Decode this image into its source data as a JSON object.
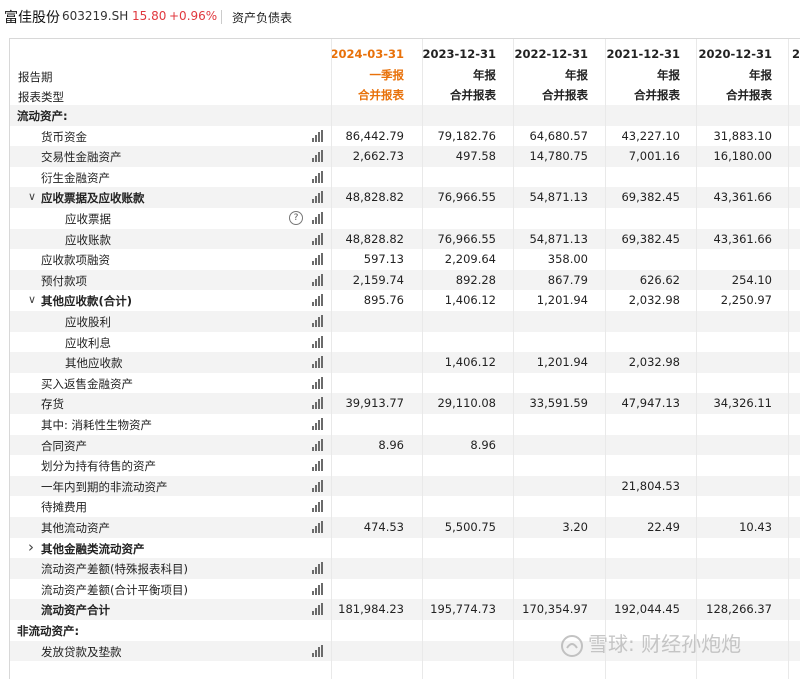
{
  "header": {
    "name": "富佳股份",
    "code": "603219.SH",
    "price": "15.80",
    "change": "+0.96%",
    "report_name": "资产负债表"
  },
  "columns": [
    {
      "date": "2024-03-31",
      "period": "一季报",
      "type": "合并报表",
      "highlight": true
    },
    {
      "date": "2023-12-31",
      "period": "年报",
      "type": "合并报表",
      "highlight": false
    },
    {
      "date": "2022-12-31",
      "period": "年报",
      "type": "合并报表",
      "highlight": false
    },
    {
      "date": "2021-12-31",
      "period": "年报",
      "type": "合并报表",
      "highlight": false
    },
    {
      "date": "2020-12-31",
      "period": "年报",
      "type": "合并报表",
      "highlight": false
    }
  ],
  "partial_column_date": "2",
  "row_labels": {
    "period_label": "报告期",
    "type_label": "报表类型"
  },
  "rows": [
    {
      "label": "流动资产:",
      "indent": 0,
      "bold": true,
      "section": true,
      "values": [
        "",
        "",
        "",
        "",
        ""
      ]
    },
    {
      "label": "货币资金",
      "indent": 1,
      "values": [
        "86,442.79",
        "79,182.76",
        "64,680.57",
        "43,227.10",
        "31,883.10"
      ]
    },
    {
      "label": "交易性金融资产",
      "indent": 1,
      "values": [
        "2,662.73",
        "497.58",
        "14,780.75",
        "7,001.16",
        "16,180.00"
      ]
    },
    {
      "label": "衍生金融资产",
      "indent": 1,
      "values": [
        "",
        "",
        "",
        "",
        ""
      ]
    },
    {
      "label": "应收票据及应收账款",
      "indent": 1,
      "bold": true,
      "chevron": "down",
      "values": [
        "48,828.82",
        "76,966.55",
        "54,871.13",
        "69,382.45",
        "43,361.66"
      ]
    },
    {
      "label": "应收票据",
      "indent": 2,
      "help": true,
      "values": [
        "",
        "",
        "",
        "",
        ""
      ]
    },
    {
      "label": "应收账款",
      "indent": 2,
      "values": [
        "48,828.82",
        "76,966.55",
        "54,871.13",
        "69,382.45",
        "43,361.66"
      ]
    },
    {
      "label": "应收款项融资",
      "indent": 1,
      "values": [
        "597.13",
        "2,209.64",
        "358.00",
        "",
        ""
      ]
    },
    {
      "label": "预付款项",
      "indent": 1,
      "values": [
        "2,159.74",
        "892.28",
        "867.79",
        "626.62",
        "254.10"
      ]
    },
    {
      "label": "其他应收款(合计)",
      "indent": 1,
      "bold": true,
      "chevron": "down",
      "values": [
        "895.76",
        "1,406.12",
        "1,201.94",
        "2,032.98",
        "2,250.97"
      ]
    },
    {
      "label": "应收股利",
      "indent": 2,
      "values": [
        "",
        "",
        "",
        "",
        ""
      ]
    },
    {
      "label": "应收利息",
      "indent": 2,
      "values": [
        "",
        "",
        "",
        "",
        ""
      ]
    },
    {
      "label": "其他应收款",
      "indent": 2,
      "values": [
        "",
        "1,406.12",
        "1,201.94",
        "2,032.98",
        ""
      ]
    },
    {
      "label": "买入返售金融资产",
      "indent": 1,
      "values": [
        "",
        "",
        "",
        "",
        ""
      ]
    },
    {
      "label": "存货",
      "indent": 1,
      "values": [
        "39,913.77",
        "29,110.08",
        "33,591.59",
        "47,947.13",
        "34,326.11"
      ]
    },
    {
      "label": "其中: 消耗性生物资产",
      "indent": 1,
      "values": [
        "",
        "",
        "",
        "",
        ""
      ]
    },
    {
      "label": "合同资产",
      "indent": 1,
      "values": [
        "8.96",
        "8.96",
        "",
        "",
        ""
      ]
    },
    {
      "label": "划分为持有待售的资产",
      "indent": 1,
      "values": [
        "",
        "",
        "",
        "",
        ""
      ]
    },
    {
      "label": "一年内到期的非流动资产",
      "indent": 1,
      "values": [
        "",
        "",
        "",
        "21,804.53",
        ""
      ]
    },
    {
      "label": "待摊费用",
      "indent": 1,
      "values": [
        "",
        "",
        "",
        "",
        ""
      ]
    },
    {
      "label": "其他流动资产",
      "indent": 1,
      "values": [
        "474.53",
        "5,500.75",
        "3.20",
        "22.49",
        "10.43"
      ]
    },
    {
      "label": "其他金融类流动资产",
      "indent": 1,
      "bold": true,
      "chevron": "right",
      "nochart": true,
      "values": [
        "",
        "",
        "",
        "",
        ""
      ]
    },
    {
      "label": "流动资产差额(特殊报表科目)",
      "indent": 1,
      "values": [
        "",
        "",
        "",
        "",
        ""
      ]
    },
    {
      "label": "流动资产差额(合计平衡项目)",
      "indent": 1,
      "values": [
        "",
        "",
        "",
        "",
        ""
      ]
    },
    {
      "label": "流动资产合计",
      "indent": 1,
      "bold": true,
      "values": [
        "181,984.23",
        "195,774.73",
        "170,354.97",
        "192,044.45",
        "128,266.37"
      ]
    },
    {
      "label": "非流动资产:",
      "indent": 0,
      "bold": true,
      "section": true,
      "values": [
        "",
        "",
        "",
        "",
        ""
      ]
    },
    {
      "label": "发放贷款及垫款",
      "indent": 1,
      "values": [
        "",
        "",
        "",
        "",
        ""
      ]
    }
  ],
  "watermark": "雪球: 财经孙炮炮",
  "colors": {
    "accent": "#e8710a",
    "red": "#e0383e",
    "stripe": "#f3f3f3"
  }
}
